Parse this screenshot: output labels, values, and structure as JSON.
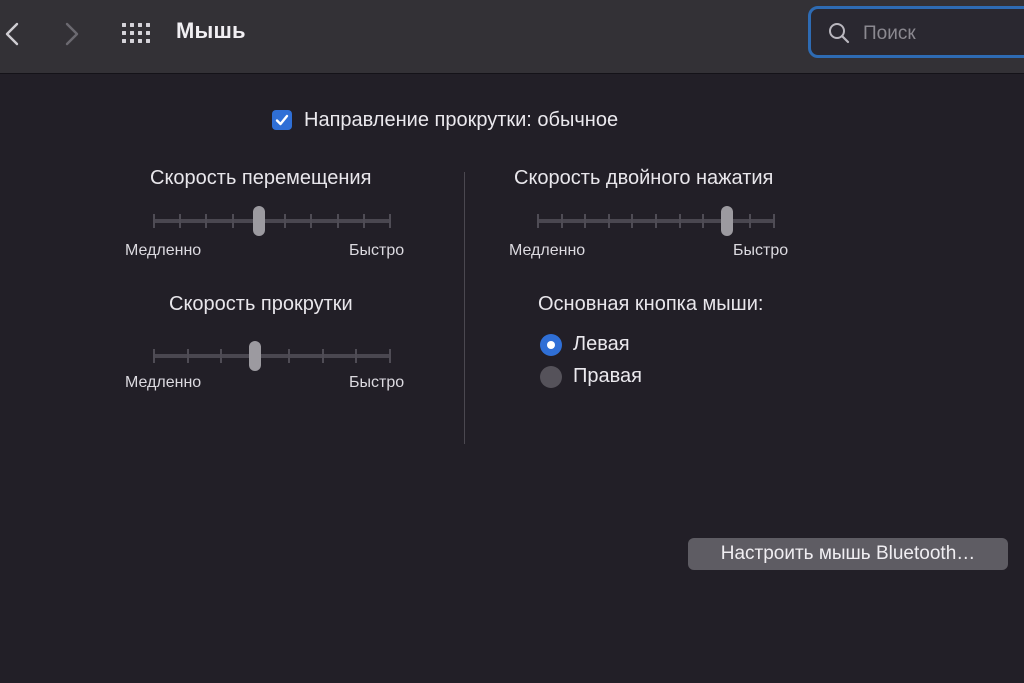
{
  "toolbar": {
    "title": "Мышь",
    "search_placeholder": "Поиск",
    "icons": {
      "back": "chevron-left-icon",
      "forward": "chevron-right-icon",
      "grid": "grid-icon",
      "search": "magnifier-icon"
    }
  },
  "scroll_direction": {
    "label": "Направление прокрутки: обычное",
    "checked": true
  },
  "tracking_speed": {
    "title": "Скорость перемещения",
    "min_label": "Медленно",
    "max_label": "Быстро",
    "ticks": 10,
    "value_step": 4
  },
  "scroll_speed": {
    "title": "Скорость прокрутки",
    "min_label": "Медленно",
    "max_label": "Быстро",
    "ticks": 8,
    "value_step": 3
  },
  "double_click_speed": {
    "title": "Скорость двойного нажатия",
    "min_label": "Медленно",
    "max_label": "Быстро",
    "ticks": 11,
    "value_step": 8
  },
  "primary_button": {
    "title": "Основная кнопка мыши:",
    "options": [
      {
        "label": "Левая",
        "selected": true
      },
      {
        "label": "Правая",
        "selected": false
      }
    ]
  },
  "bluetooth_button": {
    "label": "Настроить мышь Bluetooth…"
  },
  "colors": {
    "accent": "#2f6fd6",
    "background": "#221f27",
    "toolbar": "#333136",
    "search_border": "#2e6bb3"
  }
}
